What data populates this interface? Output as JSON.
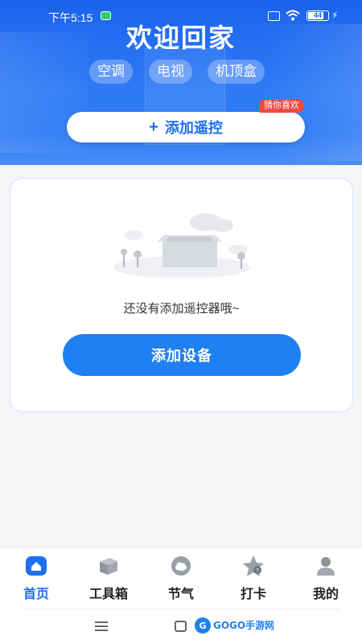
{
  "status_bar": {
    "time": "下午5:15",
    "battery": "44"
  },
  "hero": {
    "title": "欢迎回家",
    "categories": [
      "空调",
      "电视",
      "机顶盒"
    ],
    "add_remote_label": "添加遥控",
    "badge": "猜你喜欢"
  },
  "empty_state": {
    "message": "还没有添加遥控器哦~",
    "add_device_label": "添加设备"
  },
  "tabs": [
    {
      "label": "首页",
      "icon": "home-icon",
      "active": true
    },
    {
      "label": "工具箱",
      "icon": "toolbox-icon",
      "active": false
    },
    {
      "label": "节气",
      "icon": "cloud-icon",
      "active": false
    },
    {
      "label": "打卡",
      "icon": "star-checkin-icon",
      "active": false
    },
    {
      "label": "我的",
      "icon": "person-icon",
      "active": false
    }
  ],
  "watermark": "GOGO手游网",
  "colors": {
    "primary": "#1e80f1",
    "hero_blue": "#1a63ee",
    "badge_red": "#f04a3c",
    "active_tab": "#1e6ff0"
  }
}
